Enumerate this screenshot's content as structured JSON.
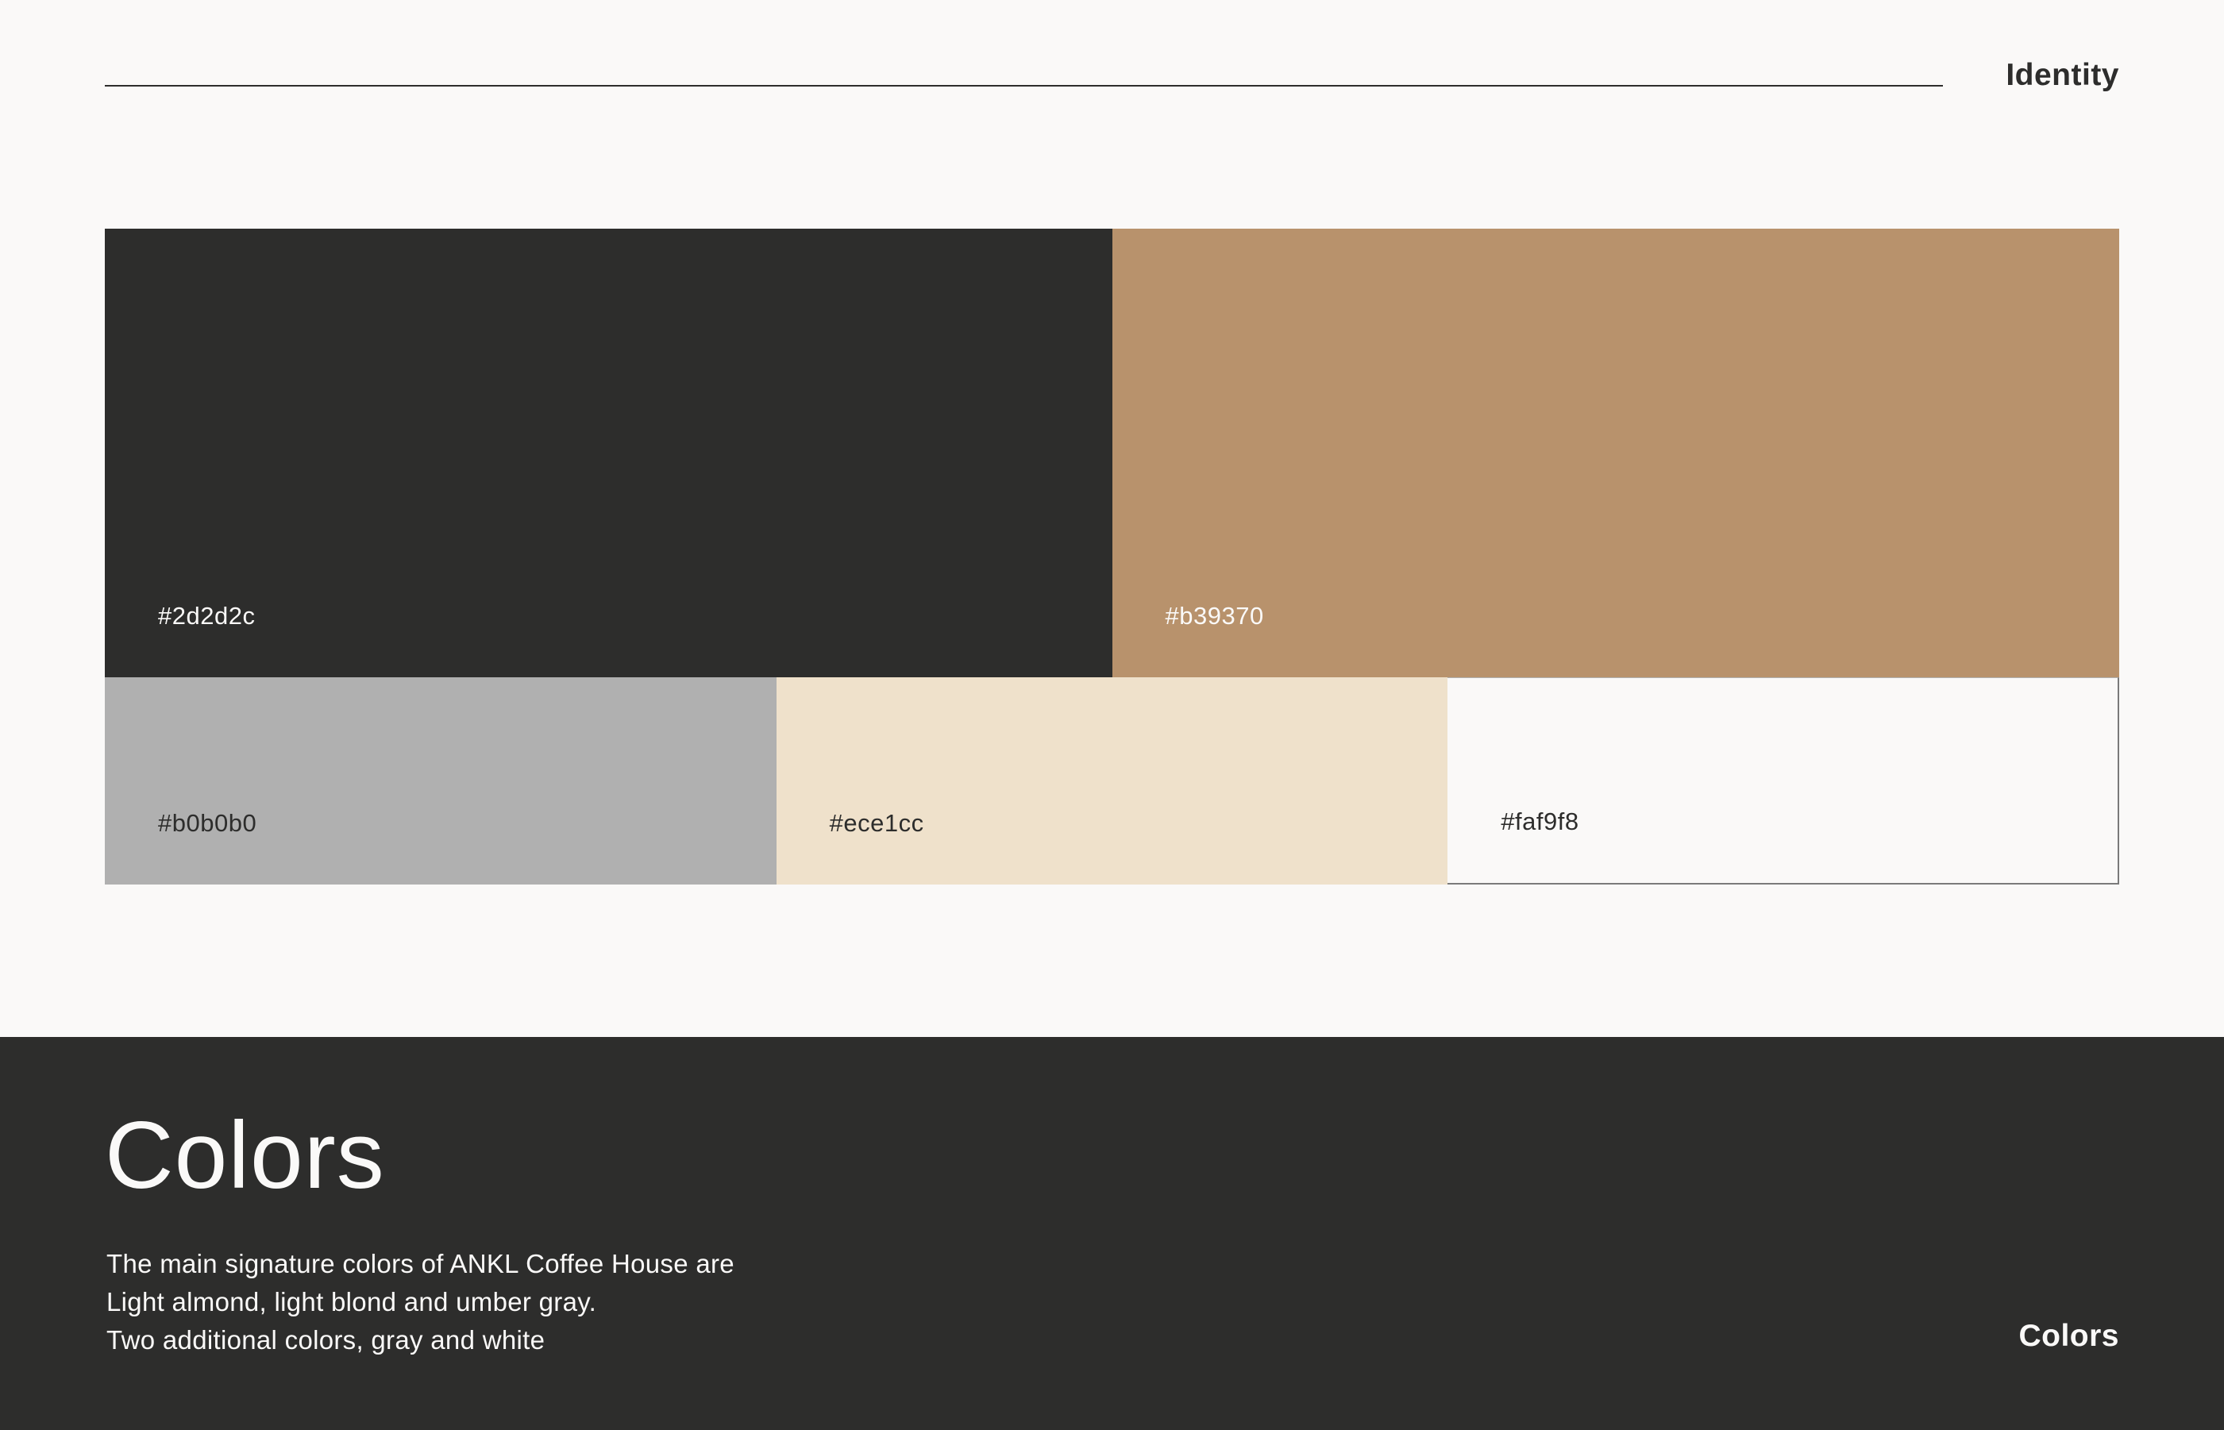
{
  "header": {
    "section_label": "Identity"
  },
  "palette": {
    "primary": [
      {
        "code": "#2d2d2c",
        "fill": "#2d2d2c",
        "text_color": "#faf9f8"
      },
      {
        "code": "#b39370",
        "fill": "#b8926c",
        "text_color": "#faf9f8"
      }
    ],
    "secondary": [
      {
        "code": "#b0b0b0",
        "fill": "#b0b0b0",
        "text_color": "#2d2d2c"
      },
      {
        "code": "#ece1cc",
        "fill": "#efe1cb",
        "text_color": "#2d2d2c"
      },
      {
        "code": "#faf9f8",
        "fill": "#faf9f8",
        "text_color": "#2d2d2c"
      }
    ]
  },
  "footer": {
    "title": "Colors",
    "description": [
      "The main signature colors of ANKL Coffee House are",
      "Light almond, light blond and umber gray.",
      "Two additional colors, gray and white"
    ],
    "section_label": "Colors",
    "background": "#2d2d2c"
  }
}
